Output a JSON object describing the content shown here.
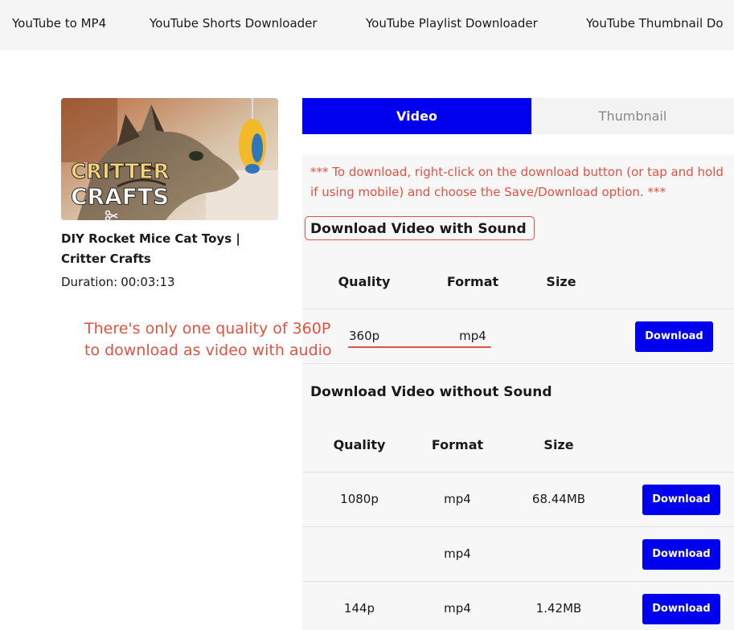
{
  "nav": {
    "items": [
      "YouTube to MP4",
      "YouTube Shorts Downloader",
      "YouTube Playlist Downloader",
      "YouTube Thumbnail Do"
    ]
  },
  "video": {
    "thumbnail_line1": "CRITTER",
    "thumbnail_line2": "CRAFTS",
    "title": "DIY Rocket Mice Cat Toys | Critter Crafts",
    "duration_label": "Duration:",
    "duration_value": "00:03:13"
  },
  "tabs": {
    "video": "Video",
    "thumbnail": "Thumbnail"
  },
  "notice": "*** To download, right-click on the download button (or tap and hold if using mobile) and choose the Save/Download option. ***",
  "with_sound": {
    "heading": "Download Video with Sound",
    "columns": [
      "Quality",
      "Format",
      "Size"
    ],
    "rows": [
      {
        "quality": "360p",
        "format": "mp4",
        "size": "",
        "button": "Download"
      }
    ]
  },
  "without_sound": {
    "heading": "Download Video without Sound",
    "columns": [
      "Quality",
      "Format",
      "Size"
    ],
    "rows": [
      {
        "quality": "1080p",
        "format": "mp4",
        "size": "68.44MB",
        "button": "Download"
      },
      {
        "quality": "",
        "format": "mp4",
        "size": "",
        "button": "Download"
      },
      {
        "quality": "144p",
        "format": "mp4",
        "size": "1.42MB",
        "button": "Download"
      }
    ]
  },
  "annotation": {
    "line1": "There's only one quality of 360P",
    "line2": "to download as video with audio"
  },
  "colors": {
    "accent_blue": "#0000ee",
    "annotation_red": "#e25241",
    "panel_bg": "#f7f7f7",
    "nav_bg": "#f5f5f5"
  }
}
